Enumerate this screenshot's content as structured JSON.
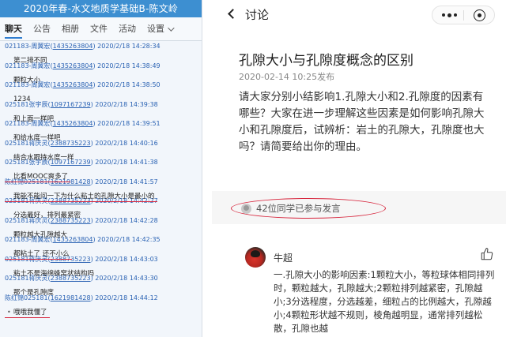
{
  "left_panel": {
    "title": "2020年春-水文地质学基础B-陈文岭",
    "tabs": [
      "聊天",
      "公告",
      "相册",
      "文件",
      "活动",
      "设置"
    ],
    "messages": [
      {
        "name": "021183-周翼宏",
        "uid": "1435263804",
        "time": "2020/2/18 14:28:34",
        "text": "第二排不同"
      },
      {
        "name": "021183-周翼宏",
        "uid": "1435263804",
        "time": "2020/2/18 14:38:49",
        "text": "颗粒大小"
      },
      {
        "name": "021183-周翼宏",
        "uid": "1435263804",
        "time": "2020/2/18 14:38:50",
        "text": "1234"
      },
      {
        "name": "025181张宇辰",
        "uid": "1097167239",
        "time": "2020/2/18 14:39:38",
        "text": "和上面一样吧"
      },
      {
        "name": "021183-周翼宏",
        "uid": "1435263804",
        "time": "2020/2/18 14:39:51",
        "text": "和给水度一样吧"
      },
      {
        "name": "025181蒋庆灵",
        "uid": "2388735223",
        "time": "2020/2/18 14:40:16",
        "text": "结合水跟持水度一样"
      },
      {
        "name": "025181张宇辰",
        "uid": "1097167239",
        "time": "2020/2/18 14:41:38",
        "text": "比看MOOC爽多了"
      },
      {
        "name": "陈红锦025181",
        "uid": "1621981428",
        "time": "2020/2/18 14:41:57",
        "text": "我能不能问一下为什么粘土的孔隙大小是最小的"
      },
      {
        "name": "025181蒋庆灵",
        "uid": "2388735223",
        "time": "2020/2/18 14:42:27",
        "text": "分选最好，排列最紧密"
      },
      {
        "name": "025181蒋庆灵",
        "uid": "2388735223",
        "time": "2020/2/18 14:42:28",
        "text": "颗粒越大孔隙越大"
      },
      {
        "name": "021183-周翼宏",
        "uid": "1435263804",
        "time": "2020/2/18 14:42:35",
        "text": "都粘土了  还不小么"
      },
      {
        "name": "025181蒋庆灵",
        "uid": "2388735223",
        "time": "2020/2/18 14:43:03",
        "text": "粘土不是海绵蜂窝状结构吗"
      },
      {
        "name": "025181蒋庆灵",
        "uid": "2388735223",
        "time": "2020/2/18 14:43:30",
        "text": "那个是孔隙度"
      },
      {
        "name": "陈红锦025181",
        "uid": "1621981428",
        "time": "2020/2/18 14:44:12",
        "text": "哦哦我懂了"
      }
    ]
  },
  "right_panel": {
    "nav_title": "讨论",
    "post": {
      "title": "孔隙大小与孔隙度概念的区别",
      "time": "2020-02-14 10:25发布",
      "body": "请大家分别小结影响1.孔隙大小和2.孔隙度的因素有哪些？大家在进一步理解这些因素是如何影响孔隙大小和孔隙度后，试辨析：岩土的孔隙大，孔隙度也大吗？请简要给出你的理由。"
    },
    "participants_text": "42位同学已参与发言",
    "comment": {
      "author": "牛超",
      "text": "一.孔隙大小的影响因素:1颗粒大小，等粒球体相同排列时，颗粒越大，孔隙越大;2颗粒排列越紧密，孔隙越小;3分选程度，分选越差，细粒占的比例越大，孔隙越小;4颗粒形状越不规则，棱角越明显，通常排列越松散，孔隙也越"
    }
  }
}
